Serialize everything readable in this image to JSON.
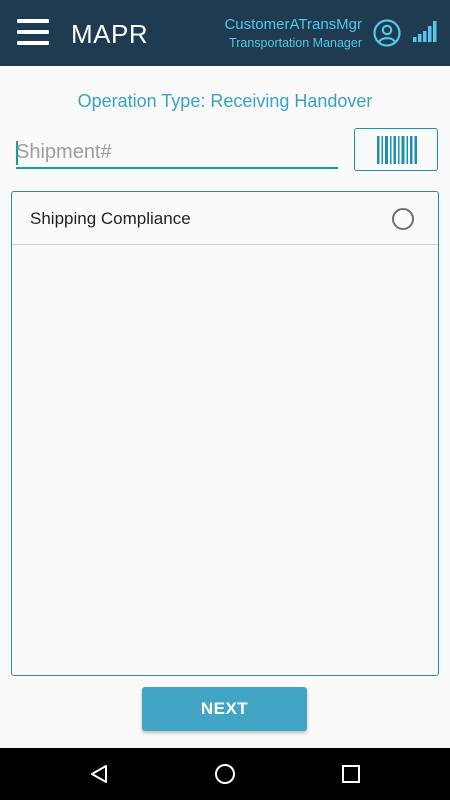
{
  "app": {
    "title": "MAPR",
    "user_name": "CustomerATransMgr",
    "user_role": "Transportation Manager"
  },
  "icons": {
    "menu": "hamburger-menu-icon",
    "avatar": "account-circle-icon",
    "signal": "signal-strength-icon",
    "scan": "barcode-icon",
    "back": "nav-back-icon",
    "home": "nav-home-icon",
    "recent": "nav-recent-apps-icon"
  },
  "operation": {
    "label": "Operation Type: Receiving Handover"
  },
  "shipment": {
    "value": "",
    "placeholder": "Shipment#"
  },
  "list": {
    "items": [
      {
        "label": "Shipping Compliance",
        "selected": false
      }
    ]
  },
  "actions": {
    "next_label": "NEXT"
  },
  "colors": {
    "appbar": "#1e3b52",
    "accent": "#42a5c6",
    "title_text": "#3aa3c2",
    "input_underline": "#1b9ca1"
  }
}
